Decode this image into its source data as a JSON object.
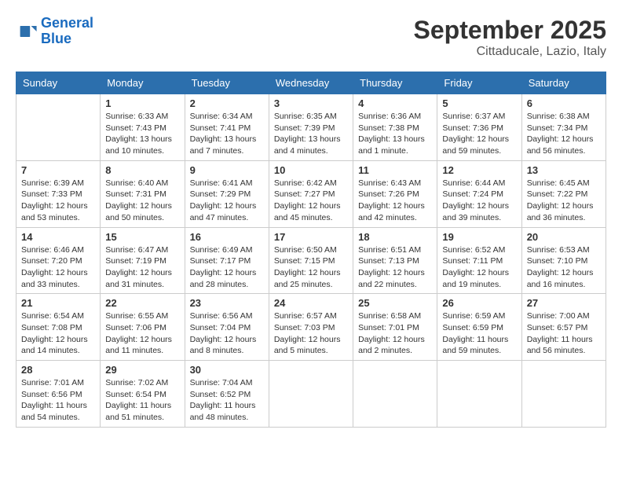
{
  "header": {
    "logo_line1": "General",
    "logo_line2": "Blue",
    "month_year": "September 2025",
    "location": "Cittaducale, Lazio, Italy"
  },
  "days_of_week": [
    "Sunday",
    "Monday",
    "Tuesday",
    "Wednesday",
    "Thursday",
    "Friday",
    "Saturday"
  ],
  "weeks": [
    [
      {
        "day": "",
        "empty": true
      },
      {
        "day": "1",
        "sunrise": "Sunrise: 6:33 AM",
        "sunset": "Sunset: 7:43 PM",
        "daylight": "Daylight: 13 hours and 10 minutes."
      },
      {
        "day": "2",
        "sunrise": "Sunrise: 6:34 AM",
        "sunset": "Sunset: 7:41 PM",
        "daylight": "Daylight: 13 hours and 7 minutes."
      },
      {
        "day": "3",
        "sunrise": "Sunrise: 6:35 AM",
        "sunset": "Sunset: 7:39 PM",
        "daylight": "Daylight: 13 hours and 4 minutes."
      },
      {
        "day": "4",
        "sunrise": "Sunrise: 6:36 AM",
        "sunset": "Sunset: 7:38 PM",
        "daylight": "Daylight: 13 hours and 1 minute."
      },
      {
        "day": "5",
        "sunrise": "Sunrise: 6:37 AM",
        "sunset": "Sunset: 7:36 PM",
        "daylight": "Daylight: 12 hours and 59 minutes."
      },
      {
        "day": "6",
        "sunrise": "Sunrise: 6:38 AM",
        "sunset": "Sunset: 7:34 PM",
        "daylight": "Daylight: 12 hours and 56 minutes."
      }
    ],
    [
      {
        "day": "7",
        "sunrise": "Sunrise: 6:39 AM",
        "sunset": "Sunset: 7:33 PM",
        "daylight": "Daylight: 12 hours and 53 minutes."
      },
      {
        "day": "8",
        "sunrise": "Sunrise: 6:40 AM",
        "sunset": "Sunset: 7:31 PM",
        "daylight": "Daylight: 12 hours and 50 minutes."
      },
      {
        "day": "9",
        "sunrise": "Sunrise: 6:41 AM",
        "sunset": "Sunset: 7:29 PM",
        "daylight": "Daylight: 12 hours and 47 minutes."
      },
      {
        "day": "10",
        "sunrise": "Sunrise: 6:42 AM",
        "sunset": "Sunset: 7:27 PM",
        "daylight": "Daylight: 12 hours and 45 minutes."
      },
      {
        "day": "11",
        "sunrise": "Sunrise: 6:43 AM",
        "sunset": "Sunset: 7:26 PM",
        "daylight": "Daylight: 12 hours and 42 minutes."
      },
      {
        "day": "12",
        "sunrise": "Sunrise: 6:44 AM",
        "sunset": "Sunset: 7:24 PM",
        "daylight": "Daylight: 12 hours and 39 minutes."
      },
      {
        "day": "13",
        "sunrise": "Sunrise: 6:45 AM",
        "sunset": "Sunset: 7:22 PM",
        "daylight": "Daylight: 12 hours and 36 minutes."
      }
    ],
    [
      {
        "day": "14",
        "sunrise": "Sunrise: 6:46 AM",
        "sunset": "Sunset: 7:20 PM",
        "daylight": "Daylight: 12 hours and 33 minutes."
      },
      {
        "day": "15",
        "sunrise": "Sunrise: 6:47 AM",
        "sunset": "Sunset: 7:19 PM",
        "daylight": "Daylight: 12 hours and 31 minutes."
      },
      {
        "day": "16",
        "sunrise": "Sunrise: 6:49 AM",
        "sunset": "Sunset: 7:17 PM",
        "daylight": "Daylight: 12 hours and 28 minutes."
      },
      {
        "day": "17",
        "sunrise": "Sunrise: 6:50 AM",
        "sunset": "Sunset: 7:15 PM",
        "daylight": "Daylight: 12 hours and 25 minutes."
      },
      {
        "day": "18",
        "sunrise": "Sunrise: 6:51 AM",
        "sunset": "Sunset: 7:13 PM",
        "daylight": "Daylight: 12 hours and 22 minutes."
      },
      {
        "day": "19",
        "sunrise": "Sunrise: 6:52 AM",
        "sunset": "Sunset: 7:11 PM",
        "daylight": "Daylight: 12 hours and 19 minutes."
      },
      {
        "day": "20",
        "sunrise": "Sunrise: 6:53 AM",
        "sunset": "Sunset: 7:10 PM",
        "daylight": "Daylight: 12 hours and 16 minutes."
      }
    ],
    [
      {
        "day": "21",
        "sunrise": "Sunrise: 6:54 AM",
        "sunset": "Sunset: 7:08 PM",
        "daylight": "Daylight: 12 hours and 14 minutes."
      },
      {
        "day": "22",
        "sunrise": "Sunrise: 6:55 AM",
        "sunset": "Sunset: 7:06 PM",
        "daylight": "Daylight: 12 hours and 11 minutes."
      },
      {
        "day": "23",
        "sunrise": "Sunrise: 6:56 AM",
        "sunset": "Sunset: 7:04 PM",
        "daylight": "Daylight: 12 hours and 8 minutes."
      },
      {
        "day": "24",
        "sunrise": "Sunrise: 6:57 AM",
        "sunset": "Sunset: 7:03 PM",
        "daylight": "Daylight: 12 hours and 5 minutes."
      },
      {
        "day": "25",
        "sunrise": "Sunrise: 6:58 AM",
        "sunset": "Sunset: 7:01 PM",
        "daylight": "Daylight: 12 hours and 2 minutes."
      },
      {
        "day": "26",
        "sunrise": "Sunrise: 6:59 AM",
        "sunset": "Sunset: 6:59 PM",
        "daylight": "Daylight: 11 hours and 59 minutes."
      },
      {
        "day": "27",
        "sunrise": "Sunrise: 7:00 AM",
        "sunset": "Sunset: 6:57 PM",
        "daylight": "Daylight: 11 hours and 56 minutes."
      }
    ],
    [
      {
        "day": "28",
        "sunrise": "Sunrise: 7:01 AM",
        "sunset": "Sunset: 6:56 PM",
        "daylight": "Daylight: 11 hours and 54 minutes."
      },
      {
        "day": "29",
        "sunrise": "Sunrise: 7:02 AM",
        "sunset": "Sunset: 6:54 PM",
        "daylight": "Daylight: 11 hours and 51 minutes."
      },
      {
        "day": "30",
        "sunrise": "Sunrise: 7:04 AM",
        "sunset": "Sunset: 6:52 PM",
        "daylight": "Daylight: 11 hours and 48 minutes."
      },
      {
        "day": "",
        "empty": true
      },
      {
        "day": "",
        "empty": true
      },
      {
        "day": "",
        "empty": true
      },
      {
        "day": "",
        "empty": true
      }
    ]
  ]
}
